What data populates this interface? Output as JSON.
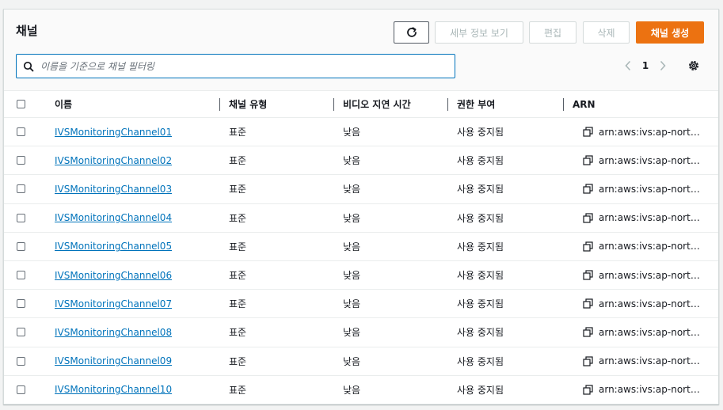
{
  "panel": {
    "title": "채널"
  },
  "toolbar": {
    "refresh_icon": "refresh-icon",
    "details_label": "세부 정보 보기",
    "edit_label": "편집",
    "delete_label": "삭제",
    "create_label": "채널 생성"
  },
  "search": {
    "placeholder": "이름을 기준으로 채널 필터링",
    "value": ""
  },
  "pagination": {
    "current_page": "1"
  },
  "table": {
    "columns": [
      "이름",
      "채널 유형",
      "비디오 지연 시간",
      "권한 부여",
      "ARN"
    ],
    "rows": [
      {
        "name": "IVSMonitoringChannel01",
        "type": "표준",
        "latency": "낮음",
        "authorization": "사용 중지됨",
        "arn": "arn:aws:ivs:ap-northe..."
      },
      {
        "name": "IVSMonitoringChannel02",
        "type": "표준",
        "latency": "낮음",
        "authorization": "사용 중지됨",
        "arn": "arn:aws:ivs:ap-northe..."
      },
      {
        "name": "IVSMonitoringChannel03",
        "type": "표준",
        "latency": "낮음",
        "authorization": "사용 중지됨",
        "arn": "arn:aws:ivs:ap-northe..."
      },
      {
        "name": "IVSMonitoringChannel04",
        "type": "표준",
        "latency": "낮음",
        "authorization": "사용 중지됨",
        "arn": "arn:aws:ivs:ap-northe..."
      },
      {
        "name": "IVSMonitoringChannel05",
        "type": "표준",
        "latency": "낮음",
        "authorization": "사용 중지됨",
        "arn": "arn:aws:ivs:ap-northe..."
      },
      {
        "name": "IVSMonitoringChannel06",
        "type": "표준",
        "latency": "낮음",
        "authorization": "사용 중지됨",
        "arn": "arn:aws:ivs:ap-northe..."
      },
      {
        "name": "IVSMonitoringChannel07",
        "type": "표준",
        "latency": "낮음",
        "authorization": "사용 중지됨",
        "arn": "arn:aws:ivs:ap-northe..."
      },
      {
        "name": "IVSMonitoringChannel08",
        "type": "표준",
        "latency": "낮음",
        "authorization": "사용 중지됨",
        "arn": "arn:aws:ivs:ap-northe..."
      },
      {
        "name": "IVSMonitoringChannel09",
        "type": "표준",
        "latency": "낮음",
        "authorization": "사용 중지됨",
        "arn": "arn:aws:ivs:ap-northe..."
      },
      {
        "name": "IVSMonitoringChannel10",
        "type": "표준",
        "latency": "낮음",
        "authorization": "사용 중지됨",
        "arn": "arn:aws:ivs:ap-northe..."
      }
    ]
  },
  "colors": {
    "primary_button": "#ec7211",
    "link": "#0073bb",
    "focus_border": "#0073bb"
  }
}
